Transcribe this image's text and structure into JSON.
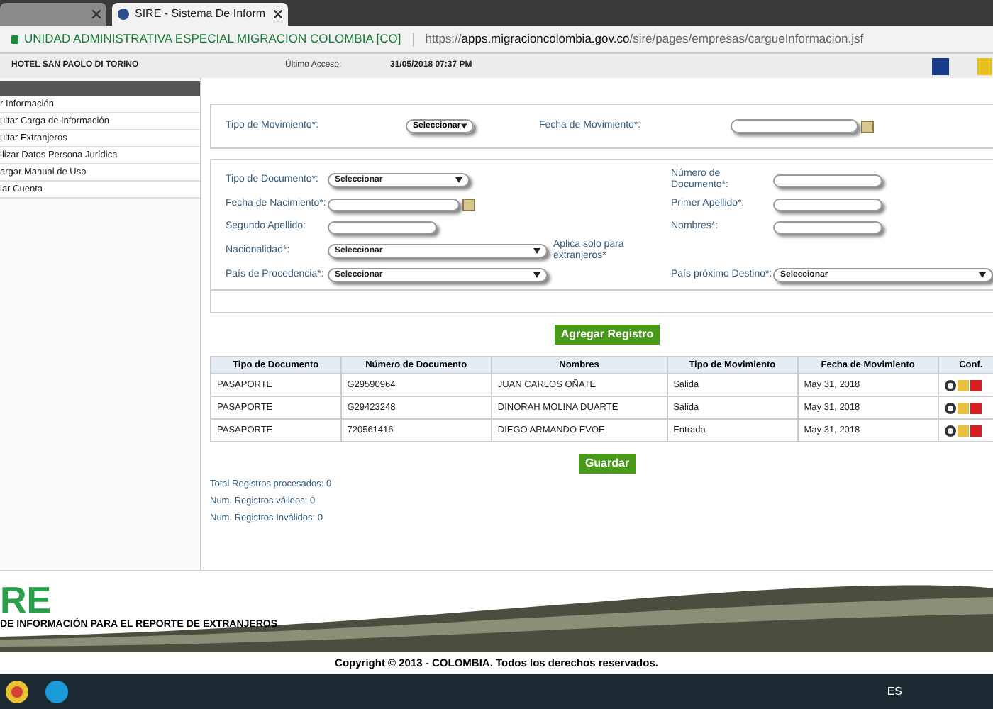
{
  "browser": {
    "tabs": [
      {
        "selected": false
      },
      {
        "title": "SIRE - Sistema De Inform",
        "selected": true
      }
    ],
    "site_name": "UNIDAD ADMINISTRATIVA ESPECIAL MIGRACION COLOMBIA [CO]",
    "url_scheme": "https://",
    "url_host": "apps.migracioncolombia.gov.co",
    "url_path": "/sire/pages/empresas/cargueInformacion.jsf"
  },
  "header": {
    "company": "HOTEL SAN PAOLO DI TORINO",
    "last_access_label": "Último Acceso:",
    "last_access": "31/05/2018 07:37 PM"
  },
  "sidebar": {
    "items": [
      {
        "label": "r Información"
      },
      {
        "label": "ultar Carga de Información"
      },
      {
        "label": "ultar Extranjeros"
      },
      {
        "label": "ilizar Datos Persona Jurídica"
      },
      {
        "label": "argar Manual de Uso"
      },
      {
        "label": "lar Cuenta"
      }
    ]
  },
  "movement_form": {
    "type_label": "Tipo de Movimiento*:",
    "type_value": "Seleccionar",
    "date_label": "Fecha de Movimiento*:"
  },
  "person_form": {
    "rows": [
      [
        {
          "kind": "select",
          "label": "Tipo de Documento*:",
          "value": "Seleccionar"
        },
        {
          "kind": "text",
          "label": "Número de Documento*:"
        }
      ],
      [
        {
          "kind": "date",
          "label": "Fecha de Nacimiento*:"
        },
        {
          "kind": "text",
          "label": "Primer Apellido*:"
        }
      ],
      [
        {
          "kind": "text",
          "label": "Segundo Apellido:"
        },
        {
          "kind": "text",
          "label": "Nombres*:"
        }
      ],
      [
        {
          "kind": "wide-select",
          "label": "Nacionalidad*:",
          "value": "Seleccionar",
          "note": "Aplica solo para extranjeros*"
        }
      ],
      [
        {
          "kind": "wide-select",
          "label": "País de Procedencia*:",
          "value": "Seleccionar"
        },
        {
          "kind": "wide-select",
          "label": "País próximo Destino*:",
          "value": "Seleccionar"
        }
      ]
    ]
  },
  "add_button": "Agregar Registro",
  "table": {
    "columns": [
      "Tipo de Documento",
      "Número de Documento",
      "Nombres",
      "Tipo de Movimiento",
      "Fecha de Movimiento",
      "Conf."
    ],
    "rows": [
      [
        "PASAPORTE",
        "G29590964",
        "JUAN CARLOS OÑATE",
        "Salida",
        "May 31, 2018"
      ],
      [
        "PASAPORTE",
        "G29423248",
        "DINORAH MOLINA DUARTE",
        "Salida",
        "May 31, 2018"
      ],
      [
        "PASAPORTE",
        "720561416",
        "DIEGO ARMANDO EVOE",
        "Entrada",
        "May 31, 2018"
      ]
    ]
  },
  "save_button": "Guardar",
  "summary": [
    "Total Registros procesados: 0",
    "Num. Registros válidos: 0",
    "Num. Registros Inválidos: 0"
  ],
  "footer": {
    "logo": "RE",
    "tagline": "DE INFORMACIÓN PARA EL REPORTE DE EXTRANJEROS",
    "copyright": "Copyright © 2013 - COLOMBIA. Todos los derechos reservados."
  },
  "taskbar": {
    "language": "ES"
  }
}
